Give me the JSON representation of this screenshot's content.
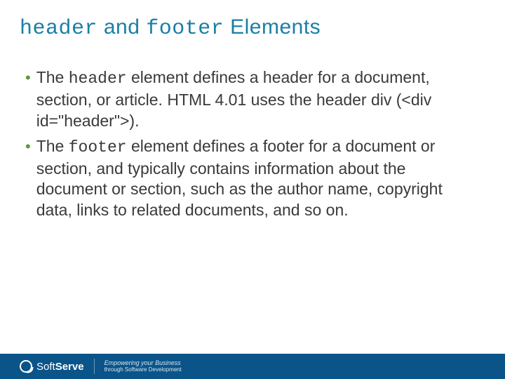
{
  "title": {
    "part1_code": "header",
    "part2": " and ",
    "part3_code": "footer",
    "part4": " Elements"
  },
  "bullets": [
    {
      "pre": "The ",
      "code": "header",
      "post": " element defines a header for a document, section, or article. HTML 4.01 uses the header div (<div id=\"header\">)."
    },
    {
      "pre": "The ",
      "code": "footer",
      "post": " element defines a footer for a document or section, and typically contains information about the document or section, such as the author name, copyright data, links to related documents, and so on."
    }
  ],
  "footer": {
    "brand_light": "Soft",
    "brand_bold": "Serve",
    "tagline_em": "Empowering your Business",
    "tagline_sub": "through Software Development"
  }
}
